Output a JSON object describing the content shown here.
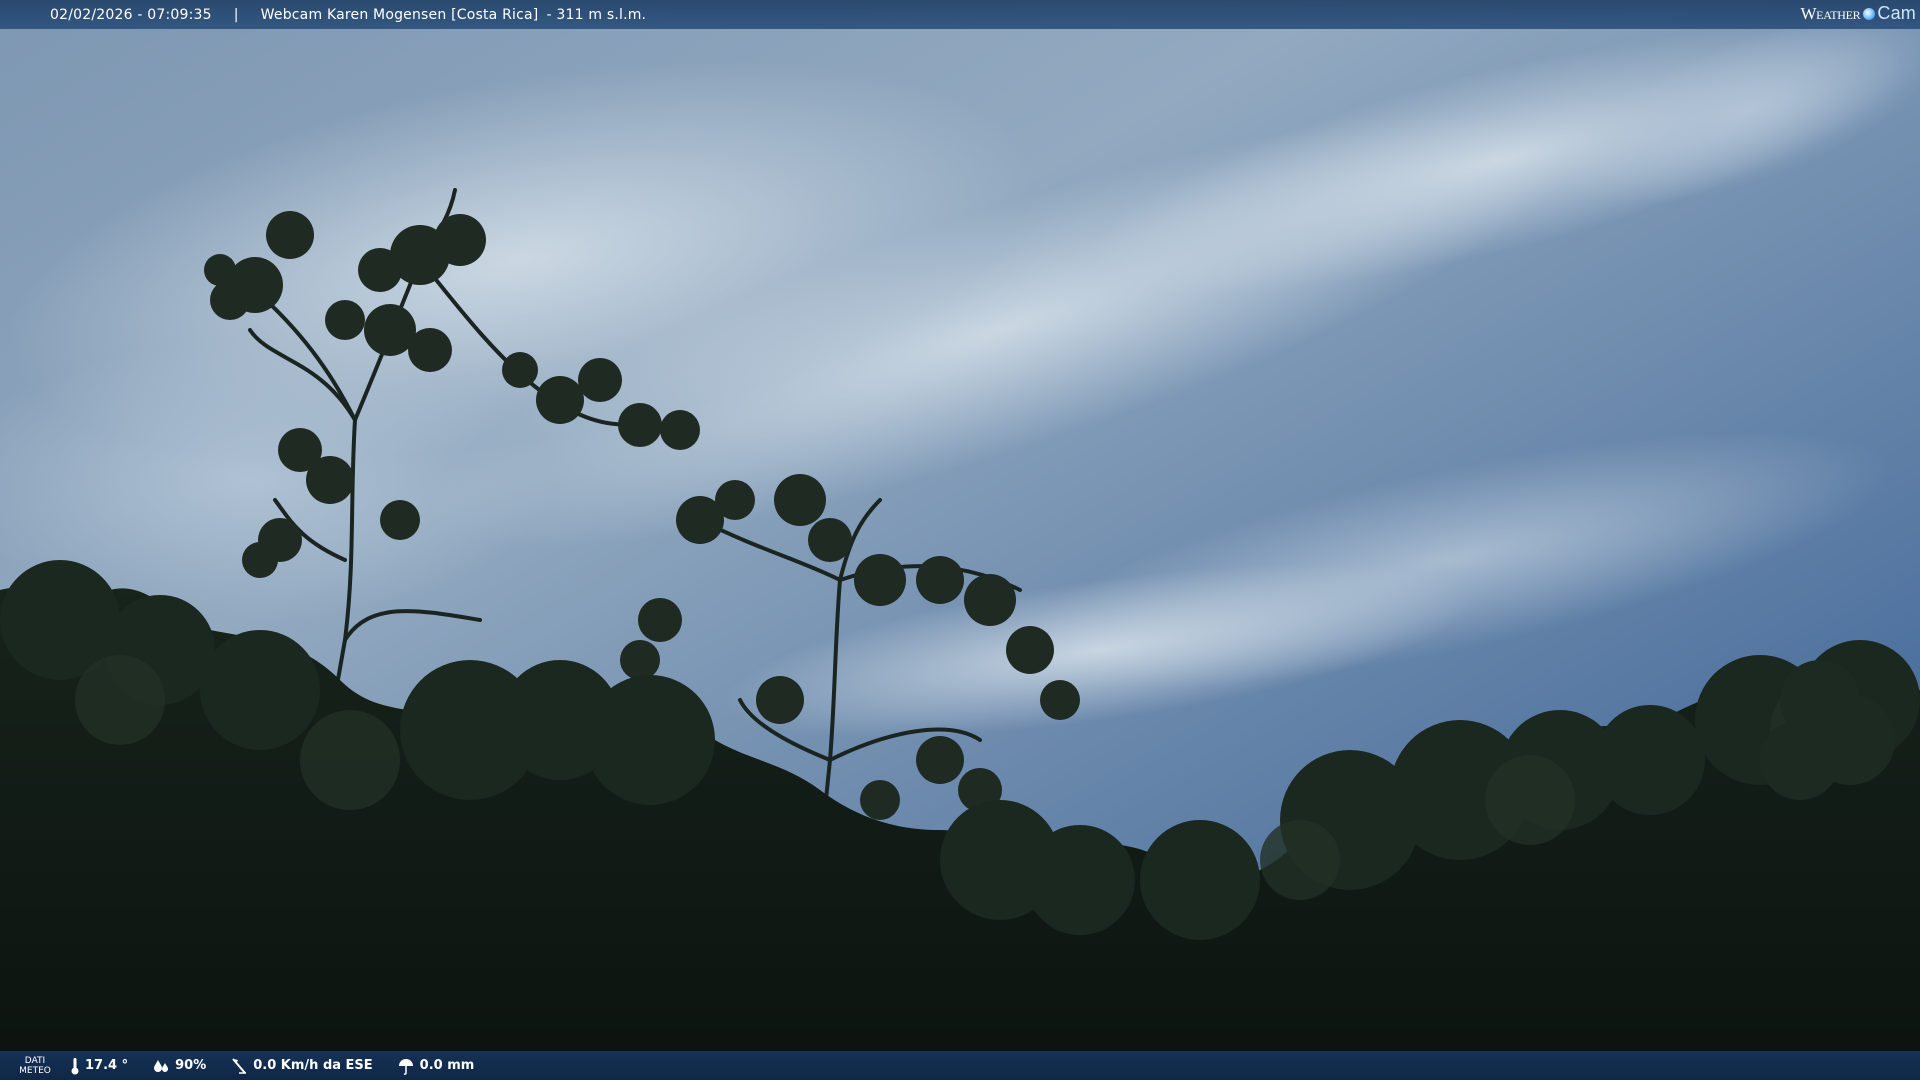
{
  "header": {
    "timestamp": "02/02/2026 - 07:09:35",
    "separator": "|",
    "title": "Webcam Karen Mogensen [Costa Rica]",
    "altitude": "- 311 m s.l.m.",
    "logo_word": "Weather",
    "logo_cam": "Cam"
  },
  "footer": {
    "dati_line1": "DATI",
    "dati_line2": "METEO",
    "temperature": "17.4 °",
    "humidity": "90%",
    "wind": "0.0 Km/h da ESE",
    "rain": "0.0 mm"
  },
  "colors": {
    "sky_top": "#4a6a92",
    "sky_mid": "#8fa7c0",
    "clouds": "#c9d6e2",
    "foliage": "#101a14",
    "bar": "#224268"
  },
  "icons": {
    "temperature": "thermometer-icon",
    "humidity": "humidity-drops-icon",
    "wind": "wind-vane-icon",
    "rain": "rain-gauge-icon",
    "logo": "weather-globe-icon"
  }
}
